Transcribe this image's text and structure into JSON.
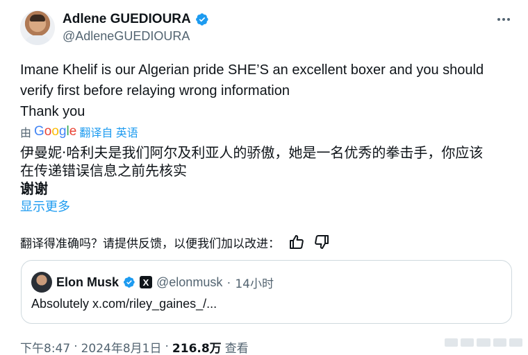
{
  "author": {
    "display_name": "Adlene GUEDIOURA",
    "handle": "@AdleneGUEDIOURA"
  },
  "tweet": {
    "lines": [
      "Imane Khelif is our Algerian pride SHE’S an excellent boxer and you should",
      "verify first before relaying wrong information",
      "Thank you"
    ]
  },
  "translation": {
    "by_prefix": "由",
    "google": [
      "G",
      "o",
      "o",
      "g",
      "l",
      "e"
    ],
    "google_colors": [
      "#4285F4",
      "#EA4335",
      "#FBBC05",
      "#4285F4",
      "#34A853",
      "#EA4335"
    ],
    "link": "翻译自 英语",
    "lines": [
      "伊曼妮·哈利夫是我们阿尔及利亚人的骄傲，她是一名优秀的拳击手，你应该",
      "在传递错误信息之前先核实",
      "谢谢"
    ],
    "show_more": "显示更多",
    "feedback_question": "翻译得准确吗？请提供反馈，以便我们加以改进："
  },
  "quote": {
    "display_name": "Elon Musk",
    "badge": "X",
    "handle": "@elonmusk",
    "dot": "·",
    "time": "14小时",
    "text": "Absolutely x.com/riley_gaines_/..."
  },
  "meta": {
    "time": "下午8:47",
    "sep1": "·",
    "date": "2024年8月1日",
    "sep2": "·",
    "views_count": "216.8万",
    "views_label": "查看"
  },
  "colors": {
    "accent": "#1d9bf0",
    "text": "#0f1419",
    "secondary": "#536471"
  }
}
